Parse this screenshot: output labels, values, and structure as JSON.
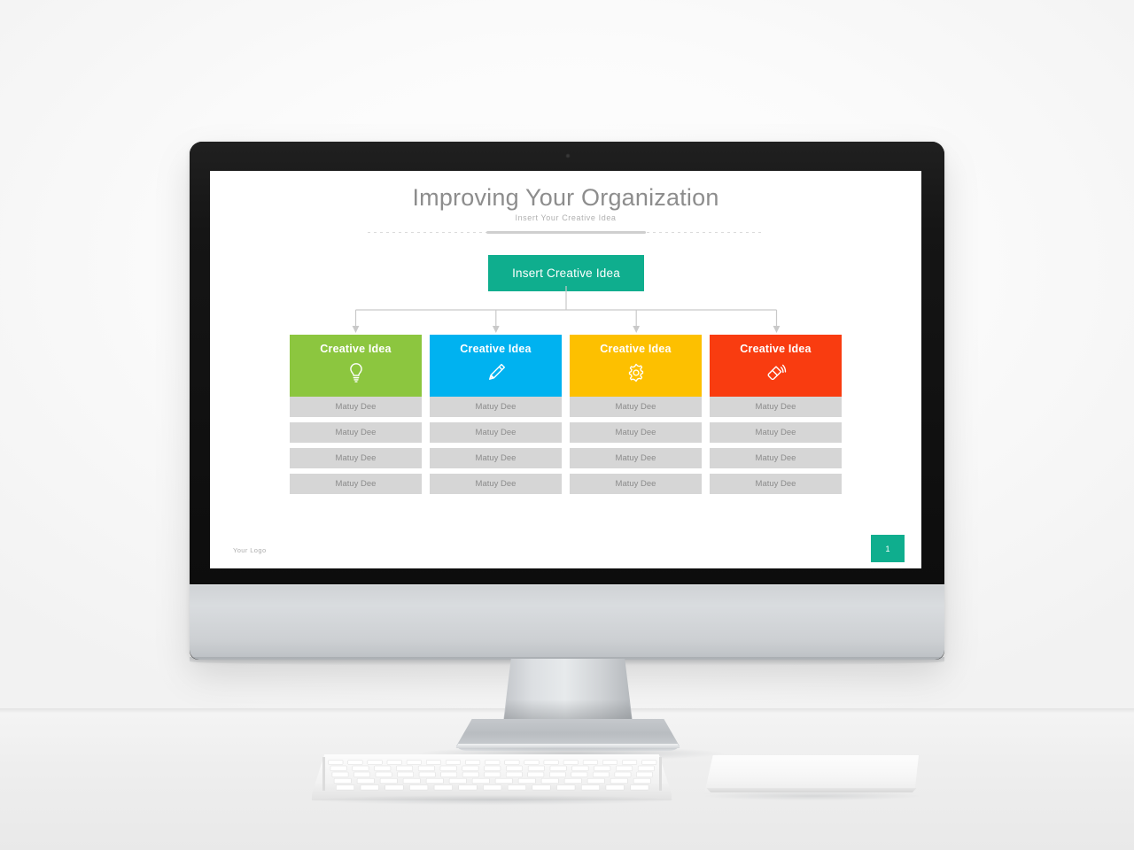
{
  "slide": {
    "title": "Improving Your Organization",
    "subtitle": "Insert Your Creative Idea",
    "root_node": {
      "label": "Insert Creative Idea",
      "color": "#0fae8e"
    },
    "columns": [
      {
        "title": "Creative Idea",
        "icon": "lightbulb-icon",
        "color": "#8cc63f",
        "rows": [
          "Matuy Dee",
          "Matuy Dee",
          "Matuy Dee",
          "Matuy Dee"
        ]
      },
      {
        "title": "Creative Idea",
        "icon": "pencil-icon",
        "color": "#00b2f0",
        "rows": [
          "Matuy Dee",
          "Matuy Dee",
          "Matuy Dee",
          "Matuy Dee"
        ]
      },
      {
        "title": "Creative Idea",
        "icon": "gear-icon",
        "color": "#fdc000",
        "rows": [
          "Matuy Dee",
          "Matuy Dee",
          "Matuy Dee",
          "Matuy Dee"
        ]
      },
      {
        "title": "Creative Idea",
        "icon": "megaphone-icon",
        "color": "#f93c10",
        "rows": [
          "Matuy Dee",
          "Matuy Dee",
          "Matuy Dee",
          "Matuy Dee"
        ]
      }
    ],
    "footer": {
      "logo_text": "Your Logo",
      "page_number": "1",
      "page_badge_color": "#0fae8e"
    },
    "row_color": "#d6d6d6",
    "title_color": "#8d8d8d"
  },
  "device": {
    "type": "desktop-computer-mockup",
    "bezel_color": "#0d0d0d",
    "chin_color": "#d4d7da",
    "peripherals": [
      "keyboard",
      "trackpad"
    ]
  }
}
